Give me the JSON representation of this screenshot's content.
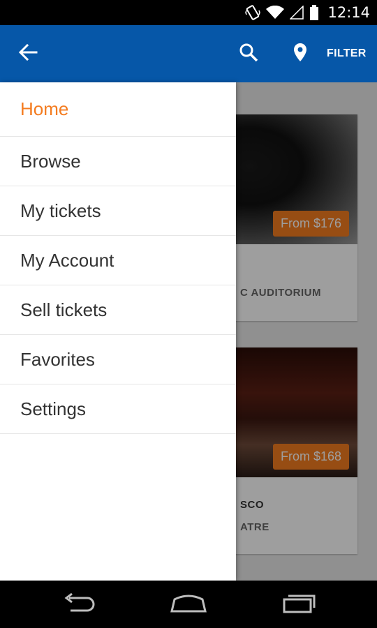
{
  "status_bar": {
    "time": "12:14",
    "icons": [
      "vibrate-icon",
      "wifi-icon",
      "signal-icon",
      "battery-icon"
    ]
  },
  "app_bar": {
    "filter_label": "FILTER",
    "icons": [
      "back-arrow-icon",
      "search-icon",
      "location-pin-icon"
    ],
    "color": "#0657a8"
  },
  "drawer": {
    "items": [
      {
        "label": "Home",
        "active": true
      },
      {
        "label": "Browse",
        "active": false
      },
      {
        "label": "My tickets",
        "active": false
      },
      {
        "label": "My Account",
        "active": false
      },
      {
        "label": "Sell tickets",
        "active": false
      },
      {
        "label": "Favorites",
        "active": false
      },
      {
        "label": "Settings",
        "active": false
      }
    ],
    "active_color": "#f47c20"
  },
  "events": [
    {
      "price": "From $176",
      "venue": "C AUDITORIUM"
    },
    {
      "price": "From $168",
      "title": "SCO",
      "venue": "ATRE"
    }
  ],
  "nav_bar": {
    "icons": [
      "nav-back-icon",
      "nav-home-icon",
      "nav-recent-apps-icon"
    ]
  }
}
